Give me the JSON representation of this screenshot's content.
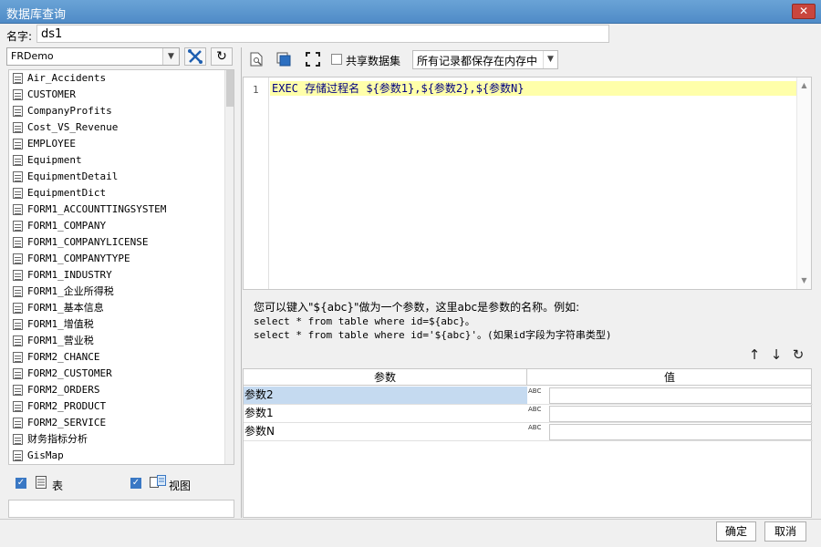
{
  "window": {
    "title": "数据库查询",
    "close_glyph": "✕"
  },
  "name": {
    "label": "名字:",
    "value": "ds1"
  },
  "left": {
    "db_value": "FRDemo",
    "tables": [
      "Air_Accidents",
      "CUSTOMER",
      "CompanyProfits",
      "Cost_VS_Revenue",
      "EMPLOYEE",
      "Equipment",
      "EquipmentDetail",
      "EquipmentDict",
      "FORM1_ACCOUNTTINGSYSTEM",
      "FORM1_COMPANY",
      "FORM1_COMPANYLICENSE",
      "FORM1_COMPANYTYPE",
      "FORM1_INDUSTRY",
      "FORM1_企业所得税",
      "FORM1_基本信息",
      "FORM1_增值税",
      "FORM1_营业税",
      "FORM2_CHANCE",
      "FORM2_CUSTOMER",
      "FORM2_ORDERS",
      "FORM2_PRODUCT",
      "FORM2_SERVICE",
      "财务指标分析",
      "GisMap"
    ],
    "check_table_label": "表",
    "check_view_label": "视图"
  },
  "toolbar": {
    "share_label": "共享数据集",
    "mem_value": "所有记录都保存在内存中"
  },
  "editor": {
    "line_number": "1",
    "code": "EXEC 存储过程名 ${参数1},${参数2},${参数N}"
  },
  "hint": {
    "line1": "您可以键入\"${abc}\"做为一个参数，这里abc是参数的名称。例如:",
    "line2": "select * from table where id=${abc}。",
    "line3": "select * from table where id='${abc}'。(如果id字段为字符串类型)"
  },
  "params": {
    "header_name": "参数",
    "header_value": "值",
    "rows": [
      {
        "name": "参数2",
        "value": ""
      },
      {
        "name": "参数1",
        "value": ""
      },
      {
        "name": "参数N",
        "value": ""
      }
    ],
    "type_glyph": "ABC"
  },
  "buttons": {
    "ok": "确定",
    "cancel": "取消"
  },
  "icons": {
    "db_dropdown": "chevron-down-icon",
    "connection": "tools-icon",
    "refresh": "refresh-icon",
    "preview": "preview-icon",
    "export": "export-icon",
    "maximize": "maximize-icon",
    "move_up": "arrow-up-icon",
    "move_down": "arrow-down-icon",
    "refresh_params": "refresh-icon"
  }
}
